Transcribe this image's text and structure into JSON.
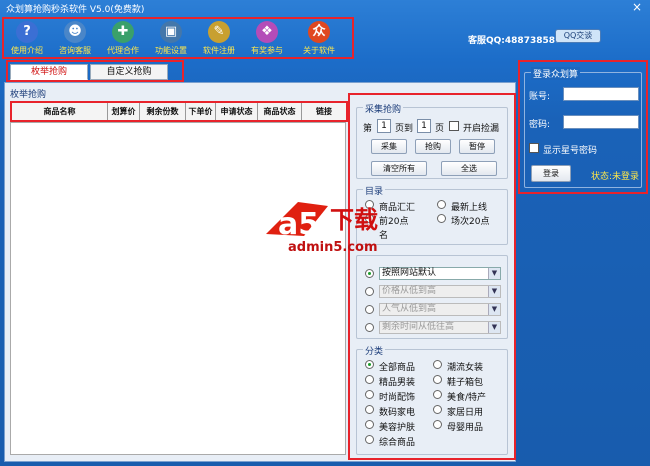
{
  "window": {
    "title": "众划算抢购秒杀软件 V5.0(免费款)",
    "close": "×"
  },
  "toolbar": {
    "items": [
      {
        "label": "使用介绍",
        "icon": "help-icon",
        "glyph": "?",
        "color": "#3b6fd4"
      },
      {
        "label": "咨询客服",
        "icon": "people-icon",
        "glyph": "☻",
        "color": "#4a86c8"
      },
      {
        "label": "代理合作",
        "icon": "network-icon",
        "glyph": "✚",
        "color": "#3aa06b"
      },
      {
        "label": "功能设置",
        "icon": "computer-icon",
        "glyph": "▣",
        "color": "#4477aa"
      },
      {
        "label": "软件注册",
        "icon": "key-icon",
        "glyph": "✎",
        "color": "#c8a030"
      },
      {
        "label": "有奖参与",
        "icon": "gift-icon",
        "glyph": "❖",
        "color": "#b44cb8"
      },
      {
        "label": "关于软件",
        "icon": "logo-icon",
        "glyph": "众",
        "color": "#e04820"
      }
    ]
  },
  "service": {
    "text": "客服QQ:488738580",
    "button": "QQ交谈"
  },
  "tabs": [
    {
      "label": "枚举抢购",
      "active": true
    },
    {
      "label": "自定义抢购",
      "active": false
    }
  ],
  "list": {
    "group_title": "枚举抢购",
    "columns": [
      "商品名称",
      "划算价",
      "剩余份数",
      "下单价",
      "申请状态",
      "商品状态",
      "链接"
    ]
  },
  "collect": {
    "legend": "采集抢购",
    "page_prefix": "第",
    "page_from": "1",
    "page_mid": "页到",
    "page_to": "1",
    "page_suffix": "页",
    "checkbox_label": "开启捡漏",
    "buttons": [
      "采集",
      "抢购",
      "暂停"
    ],
    "clear": "清空所有",
    "select_all": "全选"
  },
  "category_top": {
    "legend": "目录",
    "options": [
      "商品汇汇",
      "最新上线",
      "前20点",
      "场次20点",
      "名"
    ]
  },
  "sort": {
    "options": [
      "按照网站默认",
      "价格从低到高",
      "人气从低到高",
      "剩余时间从低往高"
    ]
  },
  "category": {
    "legend": "分类",
    "options": [
      "全部商品",
      "潮流女装",
      "精品男装",
      "鞋子箱包",
      "时尚配饰",
      "美食/特产",
      "数码家电",
      "家居日用",
      "美容护肤",
      "母婴用品",
      "综合商品"
    ]
  },
  "login": {
    "legend": "登录众划算",
    "account": "账号:",
    "password": "密码:",
    "show_pw": "显示星号密码",
    "button": "登录",
    "status": "状态:未登录"
  },
  "watermark": {
    "brand": "a5",
    "text": "下载",
    "url": "admin5.com"
  }
}
